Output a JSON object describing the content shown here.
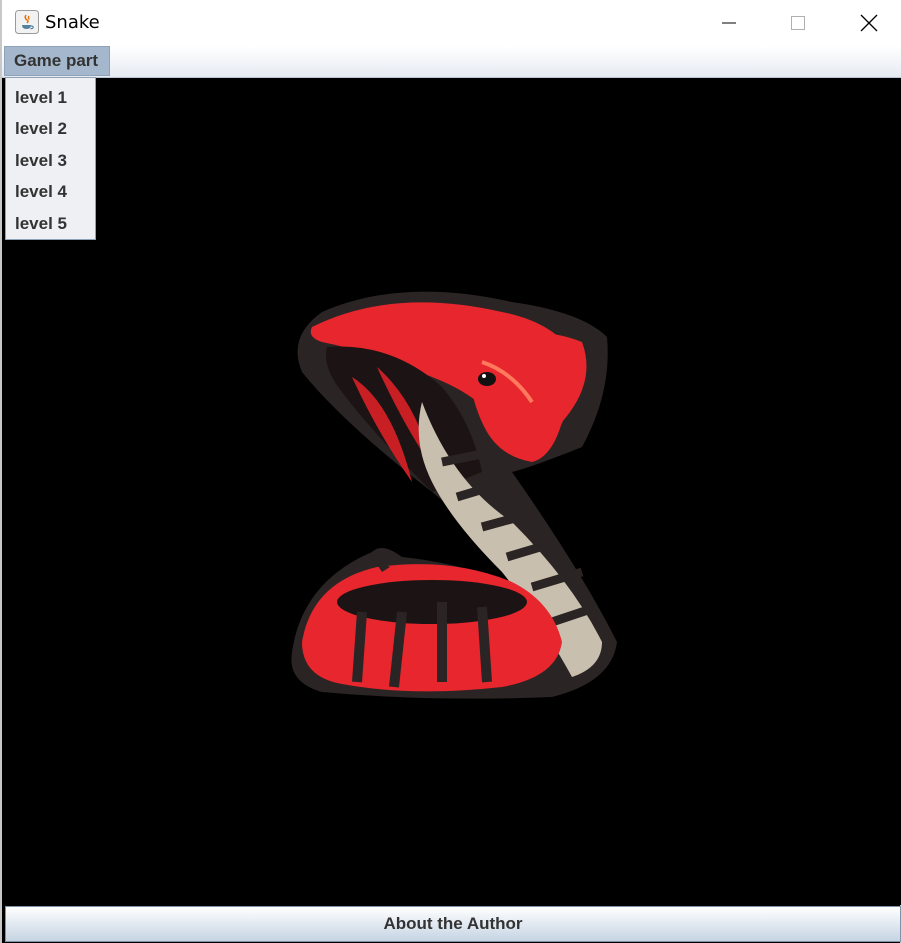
{
  "window": {
    "title": "Snake"
  },
  "menubar": {
    "menu_label": "Game part"
  },
  "levels": [
    "level 1",
    "level 2",
    "level 3",
    "level 4",
    "level 5"
  ],
  "footer": {
    "about_label": "About the Author"
  },
  "colors": {
    "menu_highlight": "#a4b7cc",
    "canvas": "#000000",
    "snake_red": "#e8262d"
  }
}
